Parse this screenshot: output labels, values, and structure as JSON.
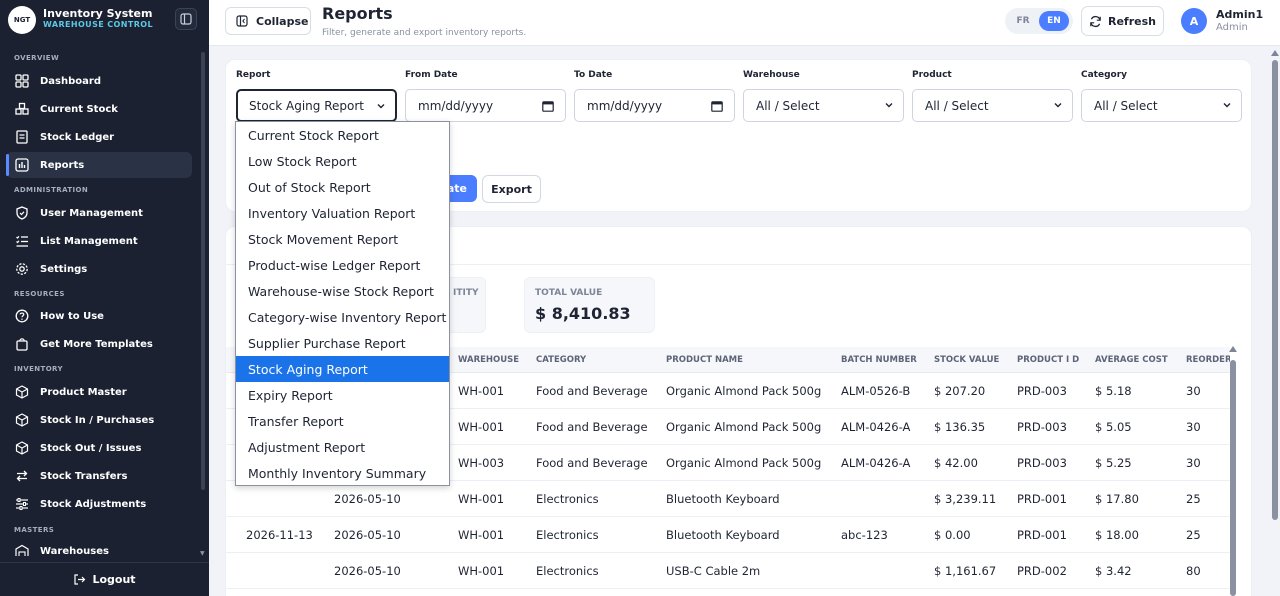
{
  "brand": {
    "logo_text": "NGT",
    "title": "Inventory System",
    "subtitle": "WAREHOUSE CONTROL"
  },
  "sidebar": {
    "sections": [
      {
        "label": "OVERVIEW"
      },
      {
        "label": "ADMINISTRATION"
      },
      {
        "label": "RESOURCES"
      },
      {
        "label": "INVENTORY"
      },
      {
        "label": "MASTERS"
      }
    ],
    "items": [
      {
        "label": "Dashboard",
        "icon": "grid-icon"
      },
      {
        "label": "Current Stock",
        "icon": "boxes-icon"
      },
      {
        "label": "Stock Ledger",
        "icon": "ledger-icon"
      },
      {
        "label": "Reports",
        "icon": "chart-icon",
        "active": true
      },
      {
        "label": "User Management",
        "icon": "shield-icon"
      },
      {
        "label": "List Management",
        "icon": "list-icon"
      },
      {
        "label": "Settings",
        "icon": "gear-icon"
      },
      {
        "label": "How to Use",
        "icon": "help-icon"
      },
      {
        "label": "Get More Templates",
        "icon": "bag-icon"
      },
      {
        "label": "Product Master",
        "icon": "cube-icon"
      },
      {
        "label": "Stock In / Purchases",
        "icon": "cube-in-icon"
      },
      {
        "label": "Stock Out / Issues",
        "icon": "cube-out-icon"
      },
      {
        "label": "Stock Transfers",
        "icon": "transfer-icon"
      },
      {
        "label": "Stock Adjustments",
        "icon": "sliders-icon"
      },
      {
        "label": "Warehouses",
        "icon": "warehouse-icon"
      }
    ],
    "logout_label": "Logout"
  },
  "header": {
    "collapse_label": "Collapse",
    "title": "Reports",
    "subtitle": "Filter, generate and export inventory reports.",
    "lang": {
      "fr": "FR",
      "en": "EN",
      "active": "EN"
    },
    "refresh_label": "Refresh",
    "user": {
      "initial": "A",
      "name": "Admin1",
      "role": "Admin"
    }
  },
  "filters": {
    "report": {
      "label": "Report",
      "value": "Stock Aging Report"
    },
    "from_date": {
      "label": "From Date",
      "value": "mm/dd/yyyy"
    },
    "to_date": {
      "label": "To Date",
      "value": "mm/dd/yyyy"
    },
    "warehouse": {
      "label": "Warehouse",
      "value": "All / Select"
    },
    "product": {
      "label": "Product",
      "value": "All / Select"
    },
    "category": {
      "label": "Category",
      "value": "All / Select"
    },
    "generate_label": "ate",
    "export_label": "Export"
  },
  "report_options": [
    "Current Stock Report",
    "Low Stock Report",
    "Out of Stock Report",
    "Inventory Valuation Report",
    "Stock Movement Report",
    "Product-wise Ledger Report",
    "Warehouse-wise Stock Report",
    "Category-wise Inventory Report",
    "Supplier Purchase Report",
    "Stock Aging Report",
    "Expiry Report",
    "Transfer Report",
    "Adjustment Report",
    "Monthly Inventory Summary"
  ],
  "selected_option_index": 9,
  "stats": {
    "quantity_label": "ITITY",
    "total_value_label": "TOTAL VALUE",
    "total_value": "$ 8,410.83"
  },
  "table": {
    "headers": [
      "WAREHOUSE",
      "CATEGORY",
      "PRODUCT NAME",
      "BATCH NUMBER",
      "STOCK VALUE",
      "PRODUCT I D",
      "AVERAGE COST",
      "REORDER"
    ],
    "rows": [
      {
        "c1": "",
        "c2": "",
        "warehouse": "WH-001",
        "category": "Food and Beverage",
        "product": "Organic Almond Pack 500g",
        "batch": "ALM-0526-B",
        "value": "$ 207.20",
        "pid": "PRD-003",
        "avg": "$ 5.18",
        "reorder": "30"
      },
      {
        "c1": "",
        "c2": "",
        "warehouse": "WH-001",
        "category": "Food and Beverage",
        "product": "Organic Almond Pack 500g",
        "batch": "ALM-0426-A",
        "value": "$ 136.35",
        "pid": "PRD-003",
        "avg": "$ 5.05",
        "reorder": "30"
      },
      {
        "c1": "",
        "c2": "",
        "warehouse": "WH-003",
        "category": "Food and Beverage",
        "product": "Organic Almond Pack 500g",
        "batch": "ALM-0426-A",
        "value": "$ 42.00",
        "pid": "PRD-003",
        "avg": "$ 5.25",
        "reorder": "30"
      },
      {
        "c1": "",
        "c2": "2026-05-10",
        "warehouse": "WH-001",
        "category": "Electronics",
        "product": "Bluetooth Keyboard",
        "batch": "",
        "value": "$ 3,239.11",
        "pid": "PRD-001",
        "avg": "$ 17.80",
        "reorder": "25"
      },
      {
        "c1": "2026-11-13",
        "c2": "2026-05-10",
        "warehouse": "WH-001",
        "category": "Electronics",
        "product": "Bluetooth Keyboard",
        "batch": "abc-123",
        "value": "$ 0.00",
        "pid": "PRD-001",
        "avg": "$ 18.00",
        "reorder": "25"
      },
      {
        "c1": "",
        "c2": "2026-05-10",
        "warehouse": "WH-001",
        "category": "Electronics",
        "product": "USB-C Cable 2m",
        "batch": "",
        "value": "$ 1,161.67",
        "pid": "PRD-002",
        "avg": "$ 3.42",
        "reorder": "80"
      }
    ]
  },
  "colors": {
    "sidebar_bg": "#1b2130",
    "accent": "#4a7dff",
    "selected_option": "#1a73e8"
  }
}
